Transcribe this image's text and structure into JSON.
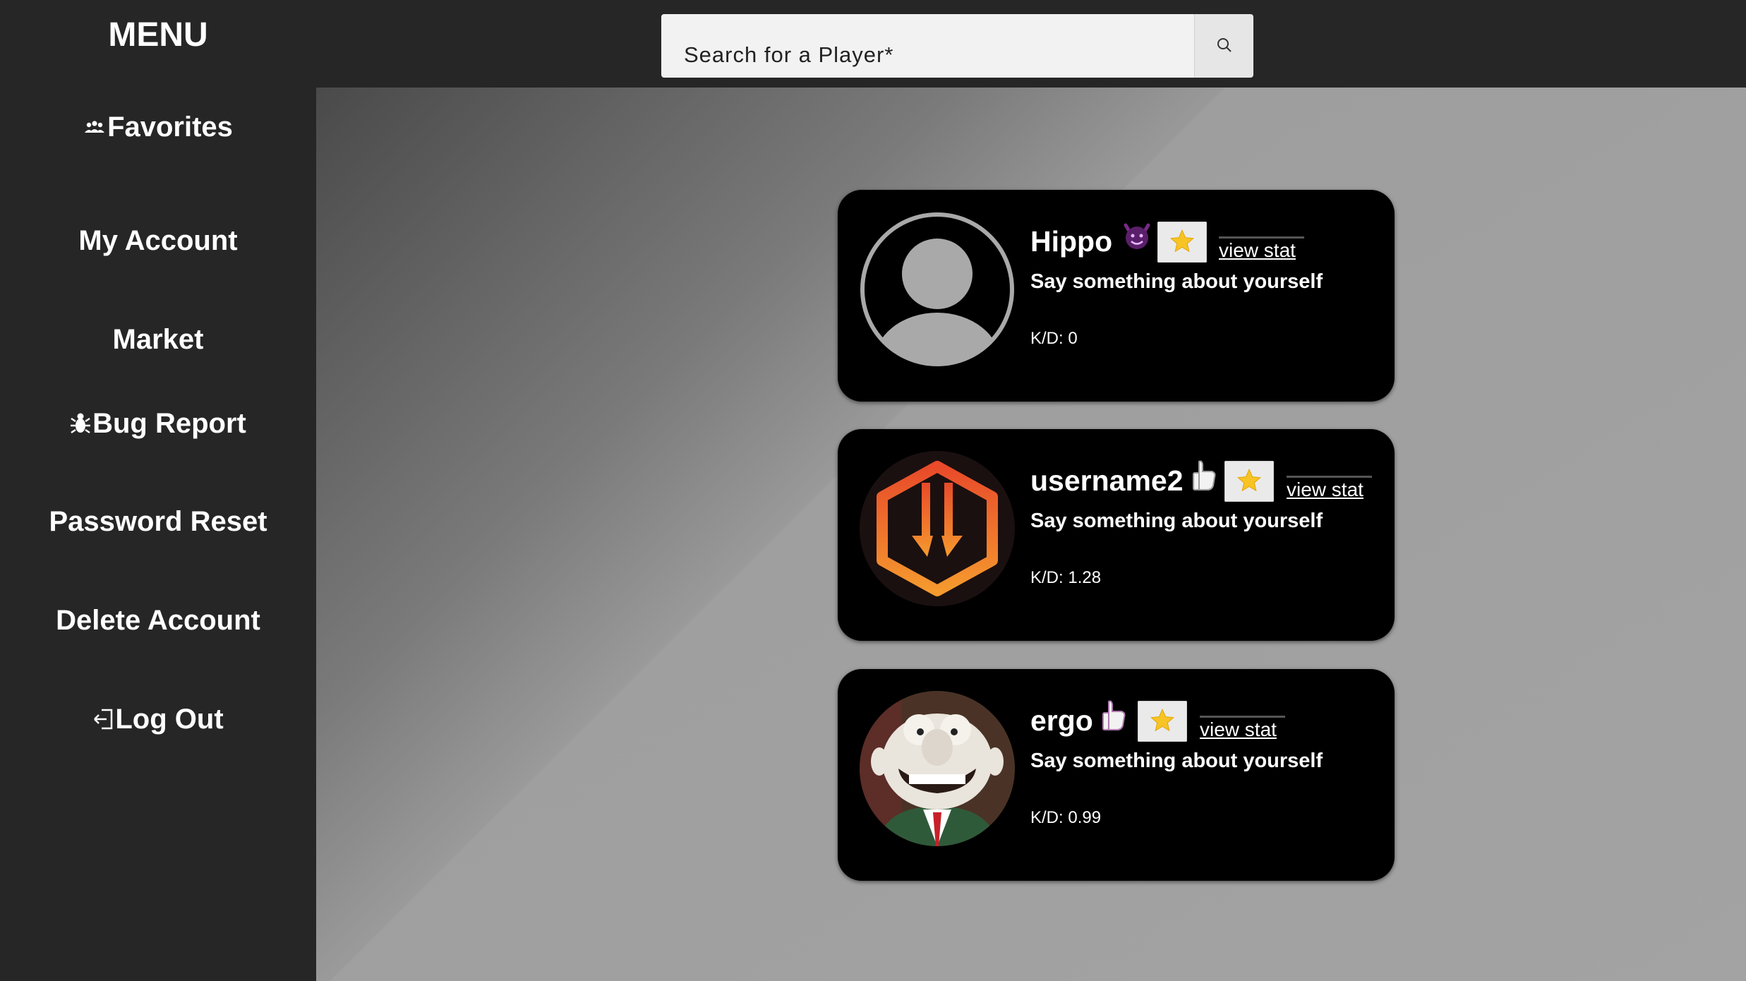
{
  "sidebar": {
    "title": "MENU",
    "items": [
      {
        "label": "Favorites",
        "icon": "group-icon"
      },
      {
        "label": "My Account",
        "icon": ""
      },
      {
        "label": "Market",
        "icon": ""
      },
      {
        "label": "Bug Report",
        "icon": "bug-icon"
      },
      {
        "label": "Password Reset",
        "icon": ""
      },
      {
        "label": "Delete Account",
        "icon": ""
      },
      {
        "label": "Log Out",
        "icon": "logout-icon"
      }
    ]
  },
  "search": {
    "placeholder": "Search for a Player*",
    "button_icon": "search-icon"
  },
  "players": [
    {
      "name": "Hippo",
      "badge_icon": "devil-emoji-icon",
      "favorite_icon": "star-icon",
      "view_stat_label": "view stat",
      "bio": "Say something about yourself",
      "kd": "K/D: 0",
      "avatar": "default-silhouette"
    },
    {
      "name": "username2",
      "badge_icon": "thumbs-up-emoji-icon",
      "favorite_icon": "star-icon",
      "view_stat_label": "view stat",
      "bio": "Say something about yourself",
      "kd": "K/D: 1.28",
      "avatar": "hexagon-logo"
    },
    {
      "name": "ergo",
      "badge_icon": "thumbs-up-emoji-icon",
      "favorite_icon": "star-icon",
      "view_stat_label": "view stat",
      "bio": "Say something about yourself",
      "kd": "K/D: 0.99",
      "avatar": "clay-character-photo"
    }
  ],
  "colors": {
    "sidebar_bg": "#262626",
    "card_bg": "#000000",
    "text": "#ffffff",
    "accent_orange": "#f0702a",
    "star": "#f7c325"
  }
}
